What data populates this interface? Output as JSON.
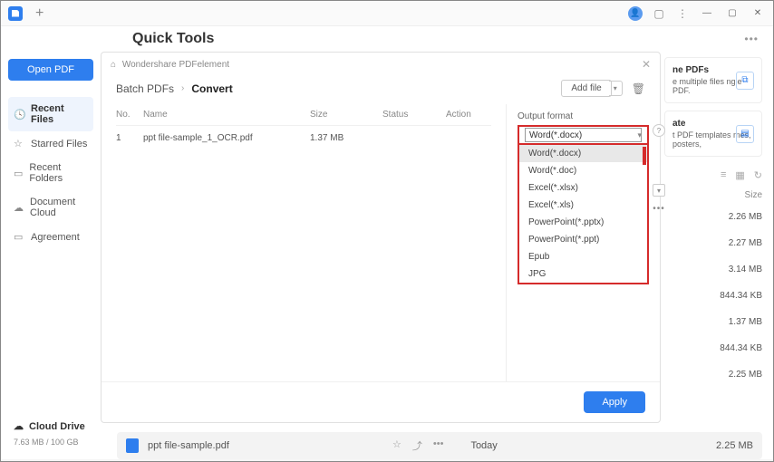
{
  "titlebar": {
    "plus": "+"
  },
  "header": {
    "title": "Quick Tools",
    "more": "•••"
  },
  "sidebar": {
    "open_pdf": "Open PDF",
    "items": [
      {
        "icon": "🕓",
        "label": "Recent Files",
        "active": true
      },
      {
        "icon": "☆",
        "label": "Starred Files",
        "active": false
      },
      {
        "icon": "▭",
        "label": "Recent Folders",
        "active": false
      },
      {
        "icon": "☁",
        "label": "Document Cloud",
        "active": false
      },
      {
        "icon": "▭",
        "label": "Agreement",
        "active": false
      }
    ],
    "cloud_drive": "Cloud Drive",
    "cloud_icon": "☁",
    "storage": "7.63 MB / 100 GB"
  },
  "bg": {
    "card1": {
      "title": "ne PDFs",
      "desc": "e multiple files ngle PDF."
    },
    "card2": {
      "title": "ate",
      "desc": "t PDF templates mes, posters,"
    },
    "size_head": "Size",
    "sizes": [
      "2.26 MB",
      "2.27 MB",
      "3.14 MB",
      "844.34 KB",
      "1.37 MB",
      "844.34 KB",
      "2.25 MB"
    ]
  },
  "recent": {
    "name": "ppt file-sample.pdf",
    "date": "Today",
    "size": "2.25 MB"
  },
  "modal": {
    "breadcrumb": "Wondershare PDFelement",
    "batch": "Batch PDFs",
    "current": "Convert",
    "add_file": "Add file",
    "trash": "🗑",
    "table": {
      "headers": {
        "no": "No.",
        "name": "Name",
        "size": "Size",
        "status": "Status",
        "action": "Action"
      },
      "rows": [
        {
          "no": "1",
          "name": "ppt file-sample_1_OCR.pdf",
          "size": "1.37 MB",
          "status": "",
          "action": ""
        }
      ]
    },
    "output_label": "Output format",
    "dropdown": {
      "selected": "Word(*.docx)",
      "options": [
        "Word(*.docx)",
        "Word(*.doc)",
        "Excel(*.xlsx)",
        "Excel(*.xls)",
        "PowerPoint(*.pptx)",
        "PowerPoint(*.ppt)",
        "Epub",
        "JPG"
      ]
    },
    "apply": "Apply"
  }
}
